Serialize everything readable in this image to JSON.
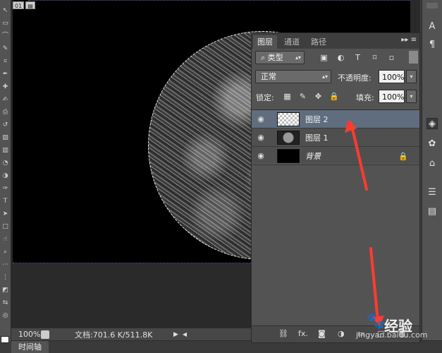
{
  "document": {
    "tab_buttons": [
      "01",
      "▤"
    ]
  },
  "status": {
    "zoom": "100%",
    "doc_info": "文档:701.6 K/511.8K"
  },
  "timeline": {
    "label": "时间轴"
  },
  "layers_panel": {
    "tabs": [
      "图层",
      "通道",
      "路径"
    ],
    "filter_kind": "类型",
    "blend_mode": "正常",
    "opacity_label": "不透明度:",
    "opacity_value": "100%",
    "lock_label": "锁定:",
    "fill_label": "填充:",
    "fill_value": "100%",
    "layers": [
      {
        "name": "图层 2",
        "selected": true,
        "thumb": "checker"
      },
      {
        "name": "图层 1",
        "selected": false,
        "thumb": "planet"
      },
      {
        "name": "背景",
        "selected": false,
        "thumb": "black",
        "locked": true
      }
    ]
  },
  "right_dock": {
    "items": [
      "A",
      "¶",
      "◈",
      "✿",
      "⌂",
      "☰",
      "▤"
    ]
  },
  "watermark": {
    "text": "经验",
    "site": "jingyan.baidu.com"
  },
  "colors": {
    "accent_selected_layer": "#5f6d7e",
    "arrow": "#ff3b30"
  }
}
